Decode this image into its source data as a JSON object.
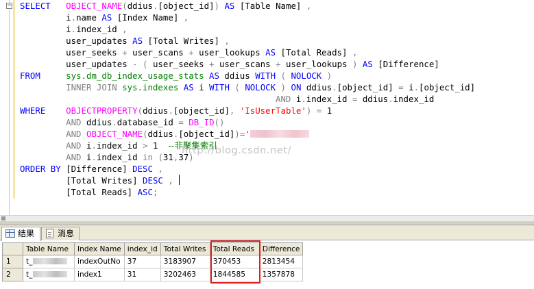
{
  "editor": {
    "lines": [
      [
        {
          "t": "SELECT",
          "c": "kw"
        },
        {
          "t": "   ",
          "c": ""
        },
        {
          "t": "OBJECT_NAME",
          "c": "fn"
        },
        {
          "t": "(",
          "c": "op"
        },
        {
          "t": "ddius",
          "c": ""
        },
        {
          "t": ".",
          "c": "op"
        },
        {
          "t": "[object_id]",
          "c": ""
        },
        {
          "t": ")",
          "c": "op"
        },
        {
          "t": " ",
          "c": ""
        },
        {
          "t": "AS",
          "c": "kw"
        },
        {
          "t": " ",
          "c": ""
        },
        {
          "t": "[Table Name]",
          "c": ""
        },
        {
          "t": " ,",
          "c": "op"
        }
      ],
      [
        {
          "t": "         i",
          "c": ""
        },
        {
          "t": ".",
          "c": "op"
        },
        {
          "t": "name ",
          "c": ""
        },
        {
          "t": "AS",
          "c": "kw"
        },
        {
          "t": " [Index Name] ",
          "c": ""
        },
        {
          "t": ",",
          "c": "op"
        }
      ],
      [
        {
          "t": "         i",
          "c": ""
        },
        {
          "t": ".",
          "c": "op"
        },
        {
          "t": "index_id ",
          "c": ""
        },
        {
          "t": ",",
          "c": "op"
        }
      ],
      [
        {
          "t": "         user_updates ",
          "c": ""
        },
        {
          "t": "AS",
          "c": "kw"
        },
        {
          "t": " [Total Writes] ",
          "c": ""
        },
        {
          "t": ",",
          "c": "op"
        }
      ],
      [
        {
          "t": "         user_seeks ",
          "c": ""
        },
        {
          "t": "+",
          "c": "op"
        },
        {
          "t": " user_scans ",
          "c": ""
        },
        {
          "t": "+",
          "c": "op"
        },
        {
          "t": " user_lookups ",
          "c": ""
        },
        {
          "t": "AS",
          "c": "kw"
        },
        {
          "t": " [Total Reads] ",
          "c": ""
        },
        {
          "t": ",",
          "c": "op"
        }
      ],
      [
        {
          "t": "         user_updates ",
          "c": ""
        },
        {
          "t": "- (",
          "c": "op"
        },
        {
          "t": " user_seeks ",
          "c": ""
        },
        {
          "t": "+",
          "c": "op"
        },
        {
          "t": " user_scans ",
          "c": ""
        },
        {
          "t": "+",
          "c": "op"
        },
        {
          "t": " user_lookups ",
          "c": ""
        },
        {
          "t": ")",
          "c": "op"
        },
        {
          "t": " ",
          "c": ""
        },
        {
          "t": "AS",
          "c": "kw"
        },
        {
          "t": " [Difference]",
          "c": ""
        }
      ],
      [
        {
          "t": "FROM",
          "c": "kw"
        },
        {
          "t": "     ",
          "c": ""
        },
        {
          "t": "sys.dm_db_index_usage_stats",
          "c": "sys"
        },
        {
          "t": " ",
          "c": ""
        },
        {
          "t": "AS",
          "c": "kw"
        },
        {
          "t": " ddius ",
          "c": ""
        },
        {
          "t": "WITH",
          "c": "kw"
        },
        {
          "t": " ",
          "c": ""
        },
        {
          "t": "(",
          "c": "op"
        },
        {
          "t": " ",
          "c": ""
        },
        {
          "t": "NOLOCK",
          "c": "kw"
        },
        {
          "t": " )",
          "c": "op"
        }
      ],
      [
        {
          "t": "         ",
          "c": ""
        },
        {
          "t": "INNER JOIN",
          "c": "op"
        },
        {
          "t": " ",
          "c": ""
        },
        {
          "t": "sys.indexes",
          "c": "sys"
        },
        {
          "t": " ",
          "c": ""
        },
        {
          "t": "AS",
          "c": "kw"
        },
        {
          "t": " i ",
          "c": ""
        },
        {
          "t": "WITH",
          "c": "kw"
        },
        {
          "t": " ",
          "c": ""
        },
        {
          "t": "(",
          "c": "op"
        },
        {
          "t": " ",
          "c": ""
        },
        {
          "t": "NOLOCK",
          "c": "kw"
        },
        {
          "t": " ",
          "c": ""
        },
        {
          "t": ")",
          "c": "op"
        },
        {
          "t": " ",
          "c": ""
        },
        {
          "t": "ON",
          "c": "kw"
        },
        {
          "t": " ddius",
          "c": ""
        },
        {
          "t": ".",
          "c": "op"
        },
        {
          "t": "[object_id] ",
          "c": ""
        },
        {
          "t": "=",
          "c": "op"
        },
        {
          "t": " i",
          "c": ""
        },
        {
          "t": ".",
          "c": "op"
        },
        {
          "t": "[object_id]",
          "c": ""
        }
      ],
      [
        {
          "t": "                                                  ",
          "c": ""
        },
        {
          "t": "AND",
          "c": "op"
        },
        {
          "t": " i",
          "c": ""
        },
        {
          "t": ".",
          "c": "op"
        },
        {
          "t": "index_id ",
          "c": ""
        },
        {
          "t": "=",
          "c": "op"
        },
        {
          "t": " ddius",
          "c": ""
        },
        {
          "t": ".",
          "c": "op"
        },
        {
          "t": "index_id",
          "c": ""
        }
      ],
      [
        {
          "t": "WHERE",
          "c": "kw"
        },
        {
          "t": "    ",
          "c": ""
        },
        {
          "t": "OBJECTPROPERTY",
          "c": "fn"
        },
        {
          "t": "(",
          "c": "op"
        },
        {
          "t": "ddius",
          "c": ""
        },
        {
          "t": ".",
          "c": "op"
        },
        {
          "t": "[object_id]",
          "c": ""
        },
        {
          "t": ",",
          "c": "op"
        },
        {
          "t": " ",
          "c": ""
        },
        {
          "t": "'IsUserTable'",
          "c": "str"
        },
        {
          "t": ")",
          "c": "op"
        },
        {
          "t": " ",
          "c": ""
        },
        {
          "t": "=",
          "c": "op"
        },
        {
          "t": " 1",
          "c": ""
        }
      ],
      [
        {
          "t": "         ",
          "c": ""
        },
        {
          "t": "AND",
          "c": "op"
        },
        {
          "t": " ddius",
          "c": ""
        },
        {
          "t": ".",
          "c": "op"
        },
        {
          "t": "database_id ",
          "c": ""
        },
        {
          "t": "=",
          "c": "op"
        },
        {
          "t": " ",
          "c": ""
        },
        {
          "t": "DB_ID",
          "c": "fn"
        },
        {
          "t": "()",
          "c": "op"
        }
      ],
      [
        {
          "t": "         ",
          "c": ""
        },
        {
          "t": "AND",
          "c": "op"
        },
        {
          "t": " ",
          "c": ""
        },
        {
          "t": "OBJECT_NAME",
          "c": "fn"
        },
        {
          "t": "(",
          "c": "op"
        },
        {
          "t": "ddius",
          "c": ""
        },
        {
          "t": ".",
          "c": "op"
        },
        {
          "t": "[object_id]",
          "c": ""
        },
        {
          "t": ")",
          "c": "op"
        },
        {
          "t": "=",
          "c": "op"
        },
        {
          "t": "'",
          "c": "str"
        },
        {
          "t": "",
          "c": "blur"
        }
      ],
      [
        {
          "t": "         ",
          "c": ""
        },
        {
          "t": "AND",
          "c": "op"
        },
        {
          "t": " i",
          "c": ""
        },
        {
          "t": ".",
          "c": "op"
        },
        {
          "t": "index_id ",
          "c": ""
        },
        {
          "t": ">",
          "c": "op"
        },
        {
          "t": " 1  ",
          "c": ""
        },
        {
          "t": "--非聚集索引",
          "c": "cm"
        }
      ],
      [
        {
          "t": "         ",
          "c": ""
        },
        {
          "t": "AND",
          "c": "op"
        },
        {
          "t": " i",
          "c": ""
        },
        {
          "t": ".",
          "c": "op"
        },
        {
          "t": "index_id ",
          "c": ""
        },
        {
          "t": "in",
          "c": "op"
        },
        {
          "t": " ",
          "c": ""
        },
        {
          "t": "(",
          "c": "op"
        },
        {
          "t": "31",
          "c": ""
        },
        {
          "t": ",",
          "c": "op"
        },
        {
          "t": "37",
          "c": ""
        },
        {
          "t": ")",
          "c": "op"
        }
      ],
      [
        {
          "t": "ORDER BY",
          "c": "kw"
        },
        {
          "t": " [Difference] ",
          "c": ""
        },
        {
          "t": "DESC",
          "c": "kw"
        },
        {
          "t": " ",
          "c": ""
        },
        {
          "t": ",",
          "c": "op"
        }
      ],
      [
        {
          "t": "         [Total Writes] ",
          "c": ""
        },
        {
          "t": "DESC",
          "c": "kw"
        },
        {
          "t": " ",
          "c": ""
        },
        {
          "t": ",",
          "c": "op"
        }
      ],
      [
        {
          "t": "         [Total Reads] ",
          "c": ""
        },
        {
          "t": "ASC",
          "c": "kw"
        },
        {
          "t": ";",
          "c": "op"
        }
      ]
    ],
    "watermark": "http://blog.csdn.net/"
  },
  "tabs": [
    {
      "label": "结果",
      "icon": "grid-icon",
      "active": true
    },
    {
      "label": "消息",
      "icon": "messages-icon",
      "active": false
    }
  ],
  "grid": {
    "columns": [
      "",
      "Table Name",
      "Index Name",
      "index_id",
      "Total Writes",
      "Total Reads",
      "Difference"
    ],
    "rows": [
      [
        "1",
        "t_",
        "indexOutNo",
        "37",
        "3183907",
        "370453",
        "2813454"
      ],
      [
        "2",
        "t_",
        "index1",
        "31",
        "3202463",
        "1844585",
        "1357878"
      ]
    ],
    "highlighted_column": "Total Reads"
  },
  "colors": {
    "keyword": "#0000ff",
    "function": "#ff00ff",
    "system_object": "#008000",
    "operator": "#808080",
    "string": "#ff0000",
    "comment": "#008000",
    "highlight_box": "#e02020"
  }
}
